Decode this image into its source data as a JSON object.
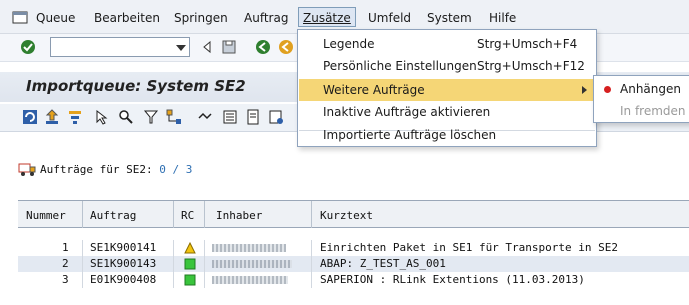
{
  "menubar": {
    "items": [
      {
        "label": "Queue"
      },
      {
        "label": "Bearbeiten"
      },
      {
        "label": "Springen"
      },
      {
        "label": "Auftrag"
      },
      {
        "label": "Zusätze"
      },
      {
        "label": "Umfeld"
      },
      {
        "label": "System"
      },
      {
        "label": "Hilfe"
      }
    ],
    "active": "Zusätze"
  },
  "toolbar": {
    "command_field_value": ""
  },
  "page": {
    "title": "Importqueue: System SE2"
  },
  "queue": {
    "label": "Aufträge für SE2:",
    "count": "0 / 3"
  },
  "table": {
    "headers": [
      "Nummer",
      "Auftrag",
      "RC",
      "Inhaber",
      "Kurztext"
    ],
    "rows": [
      {
        "nummer": "1",
        "auftrag": "SE1K900141",
        "rc": "warning",
        "kurztext": "Einrichten Paket in SE1 für Transporte in SE2"
      },
      {
        "nummer": "2",
        "auftrag": "SE1K900143",
        "rc": "ok",
        "kurztext": "ABAP: Z_TEST_AS_001"
      },
      {
        "nummer": "3",
        "auftrag": "E01K900408",
        "rc": "ok",
        "kurztext": "SAPERION : RLink Extentions (11.03.2013)"
      }
    ]
  },
  "dropdown": {
    "items": [
      {
        "label": "Legende",
        "shortcut": "Strg+Umsch+F4"
      },
      {
        "label": "Persönliche Einstellungen",
        "shortcut": "Strg+Umsch+F12"
      },
      {
        "label": "Weitere Aufträge",
        "shortcut": ""
      },
      {
        "label": "Inaktive Aufträge aktivieren",
        "shortcut": ""
      },
      {
        "label": "Importierte Aufträge löschen",
        "shortcut": ""
      }
    ],
    "highlighted": "Weitere Aufträge"
  },
  "submenu": {
    "items": [
      {
        "label": "Anhängen",
        "enabled": true
      },
      {
        "label": "In fremden Gr",
        "enabled": false
      }
    ]
  },
  "colors": {
    "highlight": "#f5d676",
    "status_ok": "#39c43c",
    "status_warning": "#f2c40f",
    "bullet": "#d62020"
  }
}
